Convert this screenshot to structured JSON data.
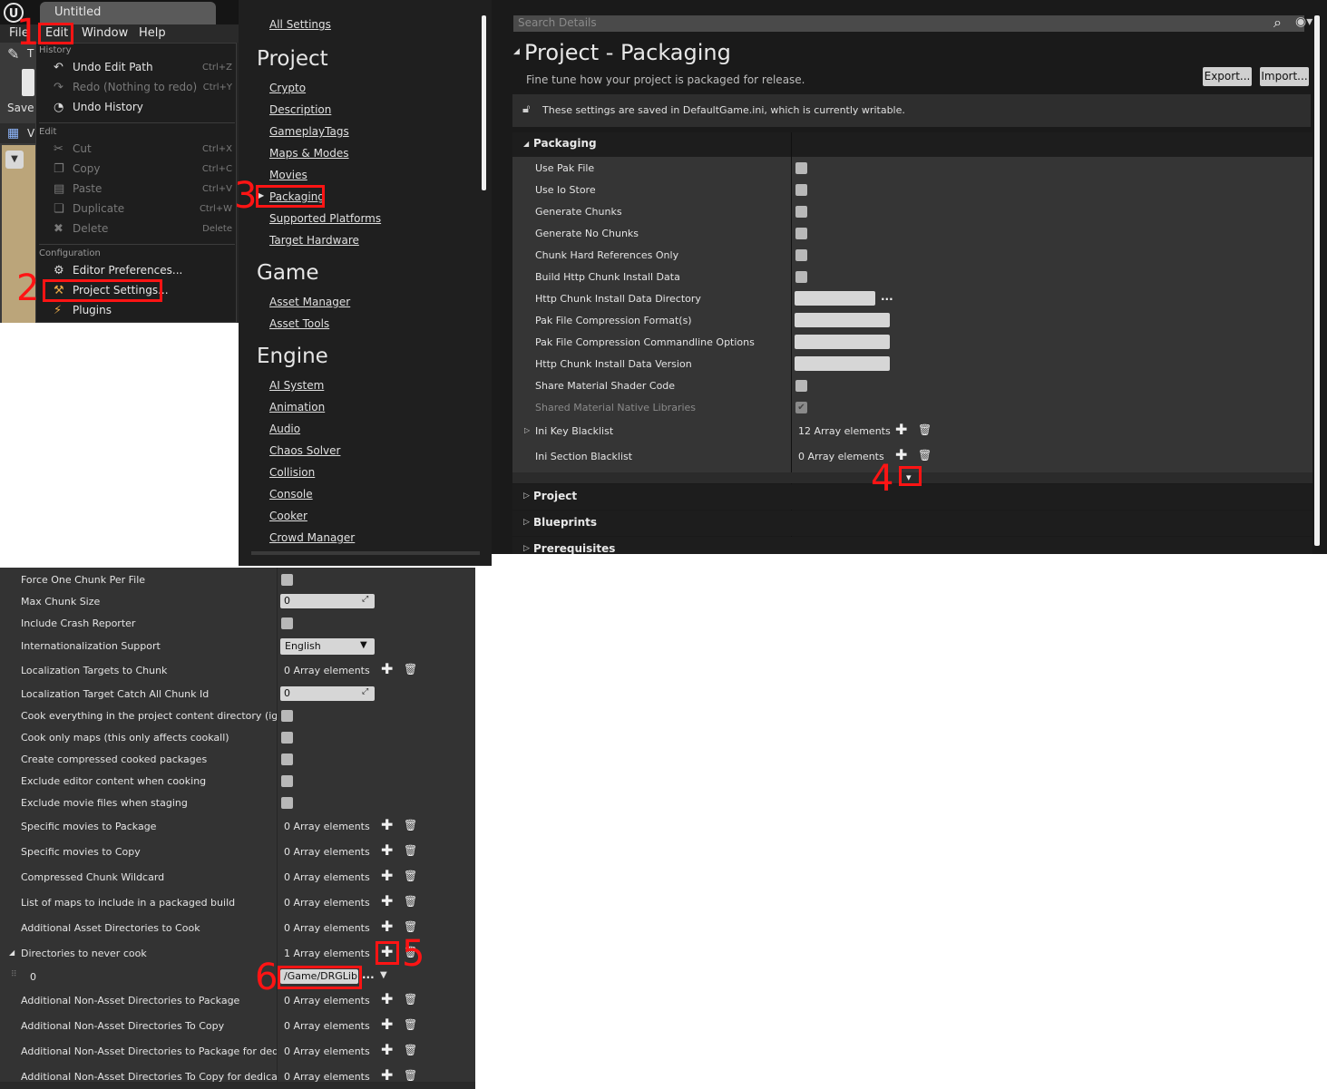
{
  "editor": {
    "logo": "U",
    "tab_title": "Untitled",
    "menubar": [
      "File",
      "Edit",
      "Window",
      "Help"
    ],
    "save_label": "Save",
    "toolbar_letter": "T",
    "view_letter": "V"
  },
  "edit_menu": {
    "sections": [
      {
        "title": "History",
        "items": [
          {
            "icon": "undo-icon",
            "glyph": "↶",
            "label": "Undo Edit Path",
            "shortcut": "Ctrl+Z",
            "enabled": true
          },
          {
            "icon": "redo-icon",
            "glyph": "↷",
            "label": "Redo (Nothing to redo)",
            "shortcut": "Ctrl+Y",
            "enabled": false
          },
          {
            "icon": "history-icon",
            "glyph": "◔",
            "label": "Undo History",
            "shortcut": "",
            "enabled": true
          }
        ]
      },
      {
        "title": "Edit",
        "items": [
          {
            "icon": "cut-icon",
            "glyph": "✂",
            "label": "Cut",
            "shortcut": "Ctrl+X",
            "enabled": false
          },
          {
            "icon": "copy-icon",
            "glyph": "❐",
            "label": "Copy",
            "shortcut": "Ctrl+C",
            "enabled": false
          },
          {
            "icon": "paste-icon",
            "glyph": "▤",
            "label": "Paste",
            "shortcut": "Ctrl+V",
            "enabled": false
          },
          {
            "icon": "duplicate-icon",
            "glyph": "❏",
            "label": "Duplicate",
            "shortcut": "Ctrl+W",
            "enabled": false
          },
          {
            "icon": "delete-icon",
            "glyph": "✖",
            "label": "Delete",
            "shortcut": "Delete",
            "enabled": false
          }
        ]
      },
      {
        "title": "Configuration",
        "items": [
          {
            "icon": "editor-preferences-icon",
            "glyph": "⚙",
            "label": "Editor Preferences...",
            "shortcut": "",
            "enabled": true
          },
          {
            "icon": "project-settings-icon",
            "glyph": "⚒",
            "label": "Project Settings...",
            "shortcut": "",
            "enabled": true
          },
          {
            "icon": "plugins-icon",
            "glyph": "⚡",
            "label": "Plugins",
            "shortcut": "",
            "enabled": true
          }
        ]
      }
    ]
  },
  "settings_nav": {
    "all_settings": "All Settings",
    "groups": [
      {
        "title": "Project",
        "links": [
          "Crypto",
          "Description",
          "GameplayTags",
          "Maps & Modes",
          "Movies",
          "Packaging",
          "Supported Platforms",
          "Target Hardware"
        ]
      },
      {
        "title": "Game",
        "links": [
          "Asset Manager",
          "Asset Tools"
        ]
      },
      {
        "title": "Engine",
        "links": [
          "AI System",
          "Animation",
          "Audio",
          "Chaos Solver",
          "Collision",
          "Console",
          "Cooker",
          "Crowd Manager"
        ]
      }
    ],
    "selected": "Packaging"
  },
  "details": {
    "search_placeholder": "Search Details",
    "title": "Project - Packaging",
    "subtitle": "Fine tune how your project is packaged for release.",
    "export_label": "Export...",
    "import_label": "Import...",
    "info_text": "These settings are saved in DefaultGame.ini, which is currently writable.",
    "packaging_category": "Packaging",
    "rows": [
      {
        "label": "Use Pak File",
        "type": "checkbox",
        "checked": false
      },
      {
        "label": "Use Io Store",
        "type": "checkbox",
        "checked": false
      },
      {
        "label": "Generate Chunks",
        "type": "checkbox",
        "checked": false
      },
      {
        "label": "Generate No Chunks",
        "type": "checkbox",
        "checked": false
      },
      {
        "label": "Chunk Hard References Only",
        "type": "checkbox",
        "checked": false
      },
      {
        "label": "Build Http Chunk Install Data",
        "type": "checkbox",
        "checked": false
      },
      {
        "label": "Http Chunk Install Data Directory",
        "type": "path",
        "value": "",
        "more": "..."
      },
      {
        "label": "Pak File Compression Format(s)",
        "type": "text",
        "value": ""
      },
      {
        "label": "Pak File Compression Commandline Options",
        "type": "text",
        "value": ""
      },
      {
        "label": "Http Chunk Install Data Version",
        "type": "text",
        "value": ""
      },
      {
        "label": "Share Material Shader Code",
        "type": "checkbox",
        "checked": false
      },
      {
        "label": "Shared Material Native Libraries",
        "type": "checkbox",
        "checked": true,
        "disabled": true
      },
      {
        "label": "Ini Key Blacklist",
        "type": "array",
        "value": "12 Array elements",
        "expandable": true
      },
      {
        "label": "Ini Section Blacklist",
        "type": "array",
        "value": "0 Array elements"
      }
    ],
    "collapsed_categories": [
      "Project",
      "Blueprints",
      "Prerequisites"
    ]
  },
  "advanced": {
    "rows": [
      {
        "label": "Force One Chunk Per File",
        "type": "checkbox"
      },
      {
        "label": "Max Chunk Size",
        "type": "number",
        "value": "0"
      },
      {
        "label": "Include Crash Reporter",
        "type": "checkbox"
      },
      {
        "label": "Internationalization Support",
        "type": "dropdown",
        "value": "English"
      },
      {
        "label": "Localization Targets to Chunk",
        "type": "array",
        "value": "0 Array elements"
      },
      {
        "label": "Localization Target Catch All Chunk Id",
        "type": "number",
        "value": "0"
      },
      {
        "label": "Cook everything in the project content directory (ignore list of maps below)",
        "type": "checkbox"
      },
      {
        "label": "Cook only maps (this only affects cookall)",
        "type": "checkbox"
      },
      {
        "label": "Create compressed cooked packages",
        "type": "checkbox"
      },
      {
        "label": "Exclude editor content when cooking",
        "type": "checkbox"
      },
      {
        "label": "Exclude movie files when staging",
        "type": "checkbox"
      },
      {
        "label": "Specific movies to Package",
        "type": "array",
        "value": "0 Array elements"
      },
      {
        "label": "Specific movies to Copy",
        "type": "array",
        "value": "0 Array elements"
      },
      {
        "label": "Compressed Chunk Wildcard",
        "type": "array",
        "value": "0 Array elements"
      },
      {
        "label": "List of maps to include in a packaged build",
        "type": "array",
        "value": "0 Array elements"
      },
      {
        "label": "Additional Asset Directories to Cook",
        "type": "array",
        "value": "0 Array elements"
      },
      {
        "label": "Directories to never cook",
        "type": "array",
        "value": "1 Array elements",
        "expanded": true
      },
      {
        "label": "0",
        "type": "element",
        "value": "/Game/DRGLib",
        "more": "..."
      },
      {
        "label": "Additional Non-Asset Directories to Package",
        "type": "array",
        "value": "0 Array elements"
      },
      {
        "label": "Additional Non-Asset Directories To Copy",
        "type": "array",
        "value": "0 Array elements"
      },
      {
        "label": "Additional Non-Asset Directories to Package for dedicated server only",
        "type": "array",
        "value": "0 Array elements"
      },
      {
        "label": "Additional Non-Asset Directories To Copy for dedicated server only",
        "type": "array",
        "value": "0 Array elements"
      }
    ]
  },
  "annotations": [
    "1",
    "2",
    "3",
    "4",
    "5",
    "6"
  ],
  "colors": {
    "annotation": "#ff1414",
    "panel": "#353535",
    "background": "#1a1a1a"
  }
}
